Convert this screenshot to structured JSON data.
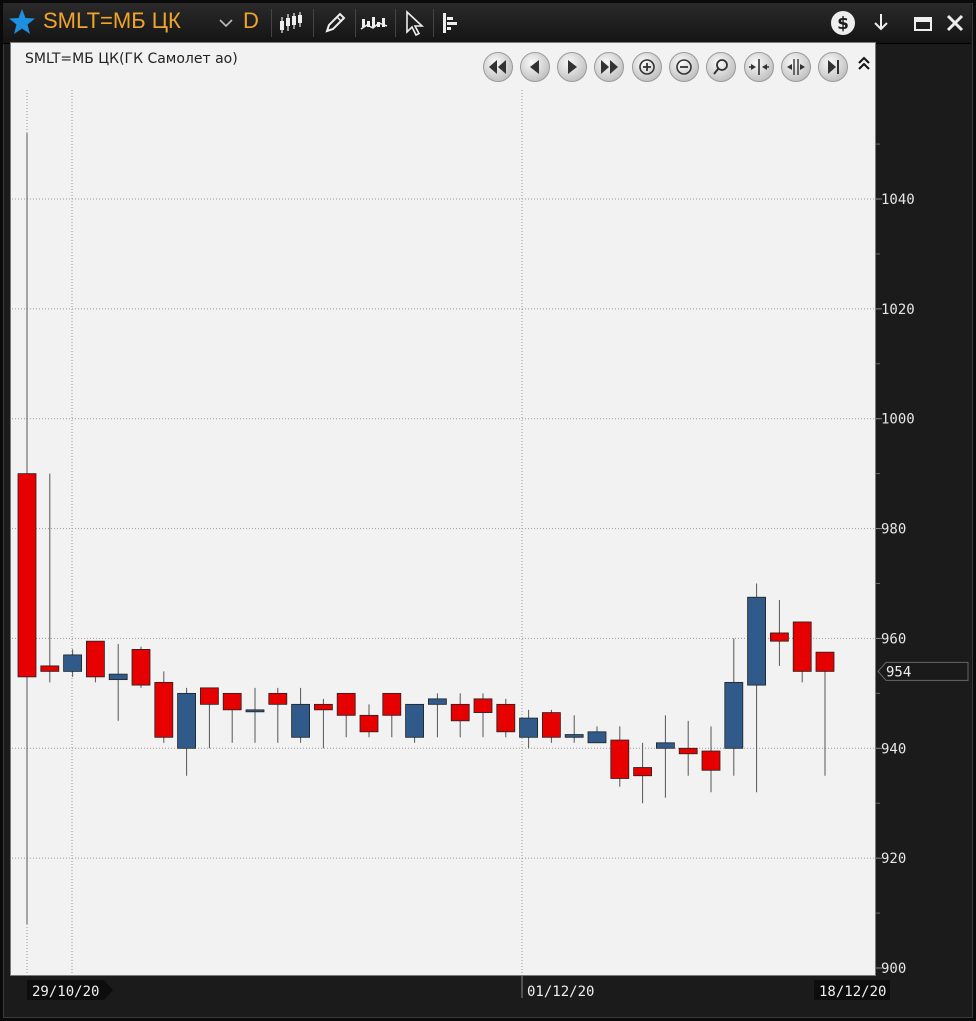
{
  "window": {
    "symbol_title": "SMLT=МБ ЦК",
    "period": "D",
    "toolbar_icons": [
      "candlestick-chart-icon",
      "pencil-icon",
      "indicators-icon",
      "cursor-icon",
      "level2-icon"
    ],
    "right_icons": [
      "dollar-circle-icon",
      "dock-down-icon",
      "minimize-icon",
      "close-icon"
    ]
  },
  "chart": {
    "instrument_label": "SMLT=МБ ЦК(ГК Самолет ао)",
    "nav_buttons": [
      "rewind-start-icon",
      "step-back-icon",
      "step-forward-icon",
      "fast-forward-icon",
      "zoom-in-icon",
      "zoom-out-icon",
      "zoom-fit-icon",
      "compress-icon",
      "expand-icon",
      "go-to-end-icon"
    ],
    "current_price_label": "954",
    "x_date_labels": [
      "29/10/20",
      "01/12/20",
      "18/12/20"
    ]
  },
  "chart_data": {
    "type": "candlestick",
    "y_ticks": [
      900,
      920,
      940,
      960,
      980,
      1000,
      1020,
      1040
    ],
    "ylim": [
      900,
      1052
    ],
    "grid": true,
    "colors": {
      "up": "#2f5a8a",
      "down": "#e60000",
      "wick": "#555555",
      "price_tag": "#1a1a1a"
    },
    "candles": [
      {
        "open": 990,
        "high": 1052,
        "low": 908,
        "close": 953
      },
      {
        "open": 955,
        "high": 990,
        "low": 952,
        "close": 954
      },
      {
        "open": 954,
        "high": 958,
        "low": 953,
        "close": 957
      },
      {
        "open": 959.5,
        "high": 959.5,
        "low": 952,
        "close": 953
      },
      {
        "open": 952.5,
        "high": 959,
        "low": 945,
        "close": 953.5
      },
      {
        "open": 958,
        "high": 958.5,
        "low": 951,
        "close": 951.5
      },
      {
        "open": 952,
        "high": 954,
        "low": 941,
        "close": 942
      },
      {
        "open": 940,
        "high": 951,
        "low": 935,
        "close": 950
      },
      {
        "open": 951,
        "high": 951,
        "low": 940,
        "close": 948
      },
      {
        "open": 950,
        "high": 950,
        "low": 941,
        "close": 947
      },
      {
        "open": 947,
        "high": 951,
        "low": 941,
        "close": 947
      },
      {
        "open": 950,
        "high": 951,
        "low": 941,
        "close": 948
      },
      {
        "open": 942,
        "high": 951,
        "low": 941,
        "close": 948
      },
      {
        "open": 948,
        "high": 949,
        "low": 940,
        "close": 947
      },
      {
        "open": 950,
        "high": 950,
        "low": 942,
        "close": 946
      },
      {
        "open": 946,
        "high": 948,
        "low": 942,
        "close": 943
      },
      {
        "open": 950,
        "high": 950,
        "low": 942,
        "close": 946
      },
      {
        "open": 942,
        "high": 948,
        "low": 941,
        "close": 948
      },
      {
        "open": 948,
        "high": 950,
        "low": 942,
        "close": 949
      },
      {
        "open": 948,
        "high": 950,
        "low": 942,
        "close": 945
      },
      {
        "open": 949,
        "high": 950,
        "low": 942,
        "close": 946.5
      },
      {
        "open": 948,
        "high": 949,
        "low": 942,
        "close": 943
      },
      {
        "open": 942,
        "high": 947,
        "low": 940,
        "close": 945.5
      },
      {
        "open": 946.5,
        "high": 947,
        "low": 941,
        "close": 942
      },
      {
        "open": 942,
        "high": 946,
        "low": 941,
        "close": 942.5
      },
      {
        "open": 941,
        "high": 944,
        "low": 941,
        "close": 943
      },
      {
        "open": 941.5,
        "high": 944,
        "low": 933,
        "close": 934.5
      },
      {
        "open": 936.5,
        "high": 941,
        "low": 930,
        "close": 935
      },
      {
        "open": 940,
        "high": 946,
        "low": 931,
        "close": 941
      },
      {
        "open": 940,
        "high": 945,
        "low": 935,
        "close": 939
      },
      {
        "open": 939.5,
        "high": 944,
        "low": 932,
        "close": 936
      },
      {
        "open": 940,
        "high": 960,
        "low": 935,
        "close": 952
      },
      {
        "open": 951.5,
        "high": 970,
        "low": 932,
        "close": 967.5
      },
      {
        "open": 961,
        "high": 967,
        "low": 955,
        "close": 959.5
      },
      {
        "open": 963,
        "high": 963,
        "low": 952,
        "close": 954
      },
      {
        "open": 957.5,
        "high": 957.5,
        "low": 935,
        "close": 954
      }
    ]
  }
}
